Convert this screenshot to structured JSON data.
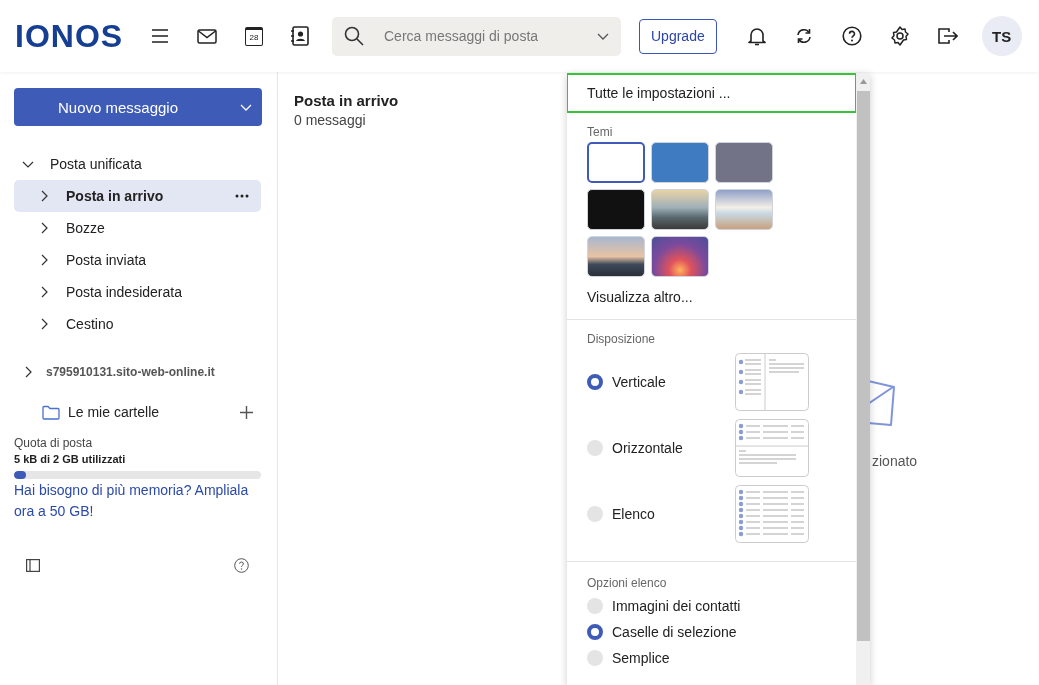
{
  "header": {
    "logo": "IONOS",
    "calendar_day": "28",
    "search": {
      "placeholder": "Cerca messaggi di posta"
    },
    "upgrade_button": "Upgrade",
    "avatar": "TS"
  },
  "sidebar": {
    "new_message_button": "Nuovo messaggio",
    "folders": [
      {
        "label": "Posta unificata",
        "expanded": true,
        "children": [
          {
            "label": "Posta in arrivo",
            "selected": true
          },
          {
            "label": "Bozze",
            "selected": false
          },
          {
            "label": "Posta inviata",
            "selected": false
          },
          {
            "label": "Posta indesiderata",
            "selected": false
          },
          {
            "label": "Cestino",
            "selected": false
          }
        ]
      }
    ],
    "account": "s795910131.sito-web-online.it",
    "my_folders": "Le mie cartelle",
    "quota": {
      "title": "Quota di posta",
      "usage": "5 kB di 2 GB utilizzati",
      "level": 0.05,
      "upgrade_link": "Hai bisogno di più memoria? Ampliala ora a 50 GB!"
    }
  },
  "message_list": {
    "title": "Posta in arrivo",
    "count": "0 messaggi"
  },
  "reading_pane": {
    "empty_text": "zionato"
  },
  "settings_menu": {
    "all_settings": "Tutte le impostazioni ...",
    "themes": {
      "title": "Temi",
      "items": [
        {
          "kind": "color",
          "color": "#ffffff",
          "selected": true
        },
        {
          "kind": "color",
          "color": "#3f7bc1",
          "selected": false
        },
        {
          "kind": "color",
          "color": "#737387",
          "selected": false
        },
        {
          "kind": "color",
          "color": "#111111",
          "selected": false
        },
        {
          "kind": "photo",
          "selected": false
        },
        {
          "kind": "photo",
          "selected": false
        },
        {
          "kind": "photo",
          "selected": false
        },
        {
          "kind": "photo",
          "selected": false
        }
      ],
      "more": "Visualizza altro..."
    },
    "layout": {
      "title": "Disposizione",
      "options": [
        {
          "label": "Verticale",
          "kind": "vertical",
          "selected": true
        },
        {
          "label": "Orizzontale",
          "kind": "horizontal",
          "selected": false
        },
        {
          "label": "Elenco",
          "kind": "list",
          "selected": false
        }
      ]
    },
    "list_options": {
      "title": "Opzioni elenco",
      "options": [
        {
          "label": "Immagini dei contatti",
          "selected": false
        },
        {
          "label": "Caselle di selezione",
          "selected": true
        },
        {
          "label": "Semplice",
          "selected": false
        }
      ]
    }
  }
}
